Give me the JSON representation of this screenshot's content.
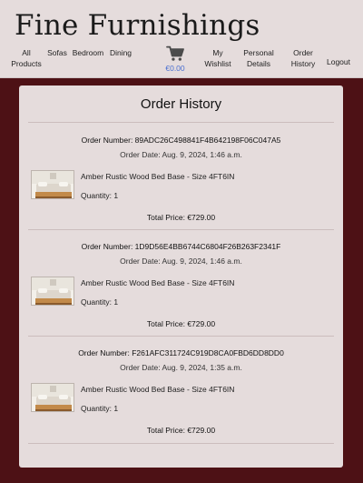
{
  "brand": "Fine Furnishings",
  "nav": {
    "all_products_line1": "All",
    "all_products_line2": "Products",
    "sofas": "Sofas",
    "bedroom": "Bedroom",
    "dining": "Dining",
    "cart_total": "€0.00",
    "my_wishlist_line1": "My",
    "my_wishlist_line2": "Wishlist",
    "personal_details_line1": "Personal",
    "personal_details_line2": "Details",
    "order_history_line1": "Order",
    "order_history_line2": "History",
    "logout": "Logout"
  },
  "page_title": "Order History",
  "colors": {
    "maroon": "#4d1115",
    "panel": "#e5dcdc",
    "cart_accent": "#4a6fd1",
    "cart_icon": "#4b4b4b"
  },
  "orders": [
    {
      "number": "Order Number: 89ADC26C498841F4B642198F06C047A5",
      "date": "Order Date: Aug. 9, 2024, 1:46 a.m.",
      "item_name": "Amber Rustic Wood Bed Base - Size 4FT6IN",
      "quantity": "Quantity: 1",
      "total": "Total Price: €729.00",
      "thumb_icon": "bed-photo"
    },
    {
      "number": "Order Number: 1D9D56E4BB6744C6804F26B263F2341F",
      "date": "Order Date: Aug. 9, 2024, 1:46 a.m.",
      "item_name": "Amber Rustic Wood Bed Base - Size 4FT6IN",
      "quantity": "Quantity: 1",
      "total": "Total Price: €729.00",
      "thumb_icon": "bed-photo"
    },
    {
      "number": "Order Number: F261AFC311724C919D8CA0FBD6DD8DD0",
      "date": "Order Date: Aug. 9, 2024, 1:35 a.m.",
      "item_name": "Amber Rustic Wood Bed Base - Size 4FT6IN",
      "quantity": "Quantity: 1",
      "total": "Total Price: €729.00",
      "thumb_icon": "bed-photo"
    }
  ]
}
